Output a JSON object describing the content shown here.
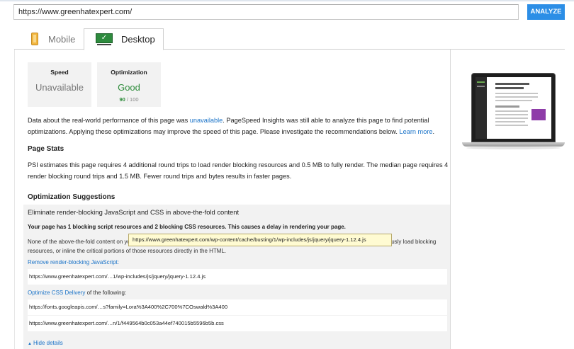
{
  "search": {
    "url_value": "https://www.greenhatexpert.com/",
    "analyze_label": "ANALYZE"
  },
  "tabs": [
    {
      "label": "Mobile",
      "active": false
    },
    {
      "label": "Desktop",
      "active": true
    }
  ],
  "scores": {
    "speed": {
      "title": "Speed",
      "value": "Unavailable"
    },
    "optimization": {
      "title": "Optimization",
      "value": "Good",
      "score": "90",
      "max": "/ 100"
    }
  },
  "intro": {
    "text_before": "Data about the real-world performance of this page was ",
    "link_unavailable": "unavailable",
    "text_after": ". PageSpeed Insights was still able to analyze this page to find potential optimizations. Applying these optimizations may improve the speed of this page. Please investigate the recommendations below. ",
    "learn_more": "Learn more",
    "period": "."
  },
  "page_stats": {
    "heading": "Page Stats",
    "text": "PSI estimates this page requires 4 additional round trips to load render blocking resources and 0.5 MB to fully render. The median page requires 4 render blocking round trips and 1.5 MB. Fewer round trips and bytes results in faster pages."
  },
  "suggestions": {
    "heading": "Optimization Suggestions",
    "item_title": "Eliminate render-blocking JavaScript and CSS in above-the-fold content",
    "bold_summary": "Your page has 1 blocking script resources and 2 blocking CSS resources. This causes a delay in rendering your page.",
    "description": "None of the above-the-fold content on your page could be rendered without waiting for the following resources to load. Try to defer or asynchronously load blocking resources, or inline the critical portions of those resources directly in the HTML.",
    "remove_js_link": "Remove render-blocking JavaScript",
    "remove_js_colon": ":",
    "js_resources": [
      "https://www.greenhatexpert.com/…1/wp-includes/js/jquery/jquery-1.12.4.js"
    ],
    "optimize_css_link": "Optimize CSS Delivery",
    "optimize_css_suffix": " of the following:",
    "css_resources": [
      "https://fonts.googleapis.com/…s?family=Lora%3A400%2C700%7COswald%3A400",
      "https://www.greenhatexpert.com/…n/1/f449564b0c053a44ef740015b5596b5b.css"
    ],
    "tooltip": "https://www.greenhatexpert.com/wp-content/cache/busting/1/wp-includes/js/jquery/jquery-1.12.4.js",
    "hide_details": "Hide details"
  },
  "colors": {
    "accent": "#2c8ee6",
    "good": "#2d8b3a",
    "link": "#1a73c8"
  },
  "icons": {
    "mobile_tab": "phone-icon",
    "desktop_tab": "monitor-icon",
    "hide_details": "triangle-up-icon"
  }
}
